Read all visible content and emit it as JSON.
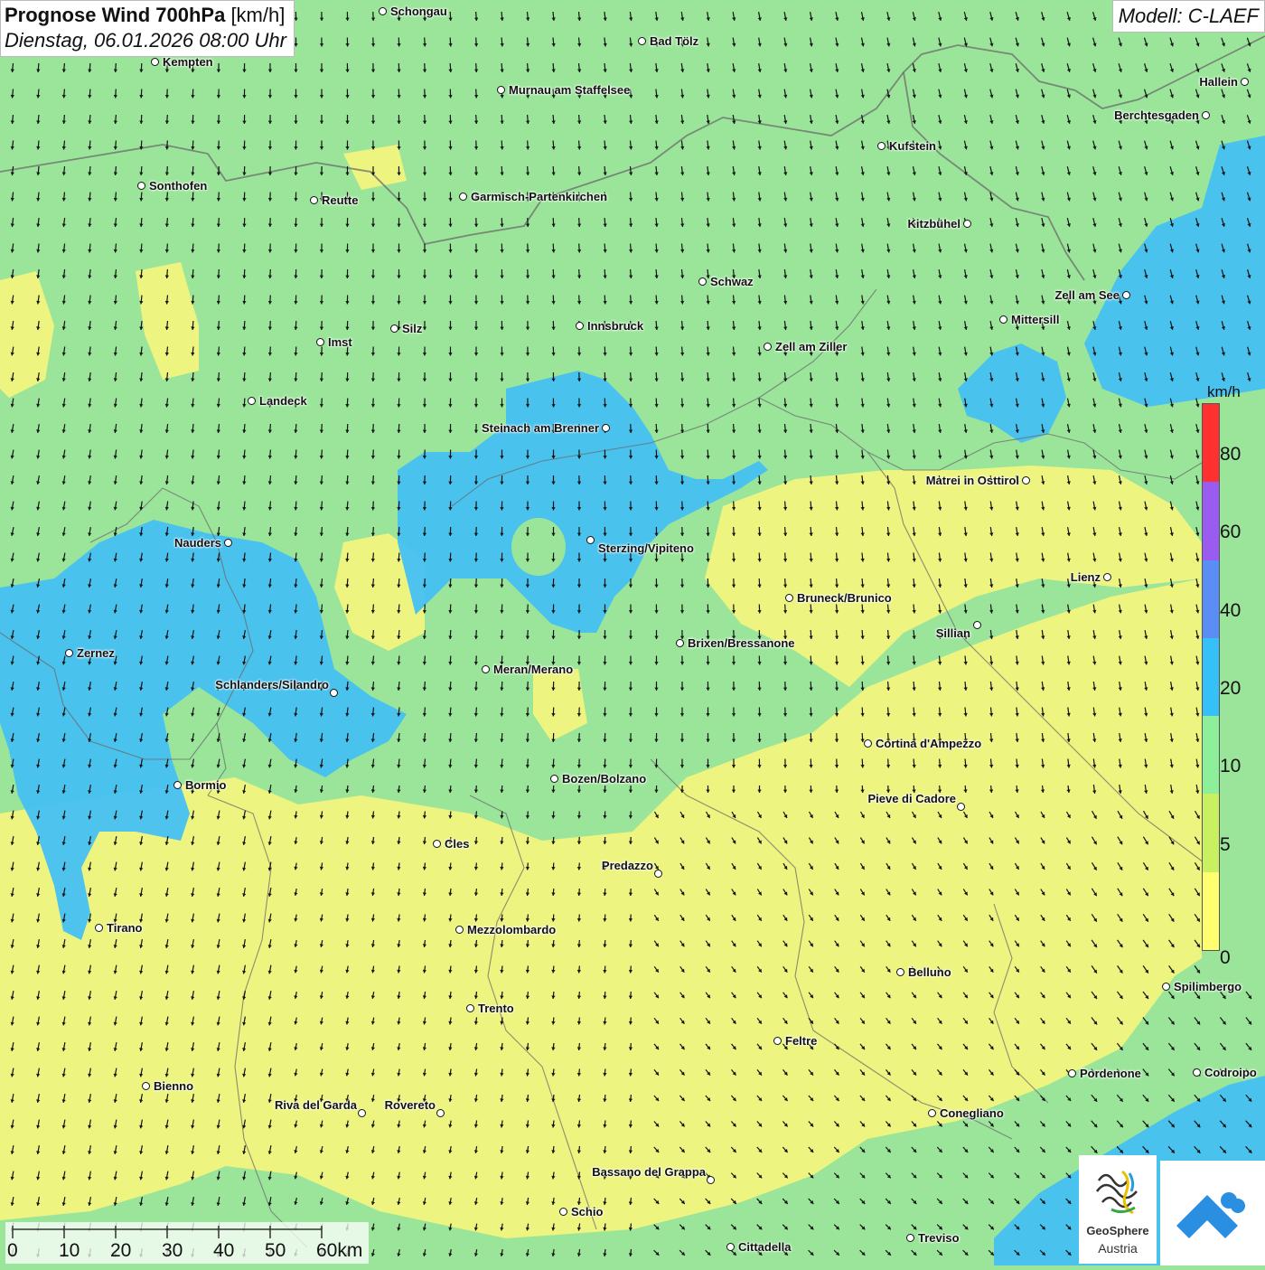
{
  "title": {
    "main_bold": "Prognose Wind 700hPa",
    "main_unit": "[km/h]",
    "datetime": "Dienstag, 06.01.2026 08:00 Uhr"
  },
  "model_label": "Modell: C-LAEF",
  "legend": {
    "unit": "km/h",
    "labels": [
      "80",
      "60",
      "40",
      "20",
      "10",
      "5",
      "0"
    ],
    "colors": [
      "#ff3030",
      "#9a5cf0",
      "#5a8ef5",
      "#35c1f7",
      "#8eef9a",
      "#c8f060",
      "#ffff70"
    ]
  },
  "scale_bar": {
    "labels": [
      "0",
      "10",
      "20",
      "30",
      "40",
      "50",
      "60km"
    ]
  },
  "logo": {
    "name": "GeoSphere",
    "sub": "Austria"
  },
  "colors": {
    "green": "#9be59b",
    "blue": "#46c0f2",
    "yellow": "#f1f47e",
    "yellow_green": "#cdf07e",
    "arrow": "#111111",
    "border": "#6a6a6a"
  },
  "cities": [
    {
      "name": "Schongau"
    },
    {
      "name": "Bad Tölz"
    },
    {
      "name": "Kempten"
    },
    {
      "name": "Murnau am Staffelsee"
    },
    {
      "name": "Hallein"
    },
    {
      "name": "Berchtesgaden"
    },
    {
      "name": "Kufstein"
    },
    {
      "name": "Sonthofen"
    },
    {
      "name": "Reutte"
    },
    {
      "name": "Garmisch-Partenkirchen"
    },
    {
      "name": "Kitzbühel"
    },
    {
      "name": "Schwaz"
    },
    {
      "name": "Zell am See"
    },
    {
      "name": "Mittersill"
    },
    {
      "name": "Innsbruck"
    },
    {
      "name": "Silz"
    },
    {
      "name": "Imst"
    },
    {
      "name": "Zell am Ziller"
    },
    {
      "name": "Landeck"
    },
    {
      "name": "Steinach am Brenner"
    },
    {
      "name": "Matrei in Osttirol"
    },
    {
      "name": "Nauders"
    },
    {
      "name": "Sterzing/Vipiteno"
    },
    {
      "name": "Lienz"
    },
    {
      "name": "Bruneck/Brunico"
    },
    {
      "name": "Sillian"
    },
    {
      "name": "Brixen/Bressanone"
    },
    {
      "name": "Zernez"
    },
    {
      "name": "Meran/Merano"
    },
    {
      "name": "Schlanders/Silandro"
    },
    {
      "name": "Cortina d'Ampezzo"
    },
    {
      "name": "Bozen/Bolzano"
    },
    {
      "name": "Bormio"
    },
    {
      "name": "Pieve di Cadore"
    },
    {
      "name": "Cles"
    },
    {
      "name": "Predazzo"
    },
    {
      "name": "Tirano"
    },
    {
      "name": "Mezzolombardo"
    },
    {
      "name": "Belluno"
    },
    {
      "name": "Spilimbergo"
    },
    {
      "name": "Trento"
    },
    {
      "name": "Feltre"
    },
    {
      "name": "Pordenone"
    },
    {
      "name": "Codroipo"
    },
    {
      "name": "Bienno"
    },
    {
      "name": "Riva del Garda"
    },
    {
      "name": "Rovereto"
    },
    {
      "name": "Conegliano"
    },
    {
      "name": "Bassano del Grappa"
    },
    {
      "name": "Schio"
    },
    {
      "name": "Treviso"
    },
    {
      "name": "Cittadella"
    }
  ]
}
